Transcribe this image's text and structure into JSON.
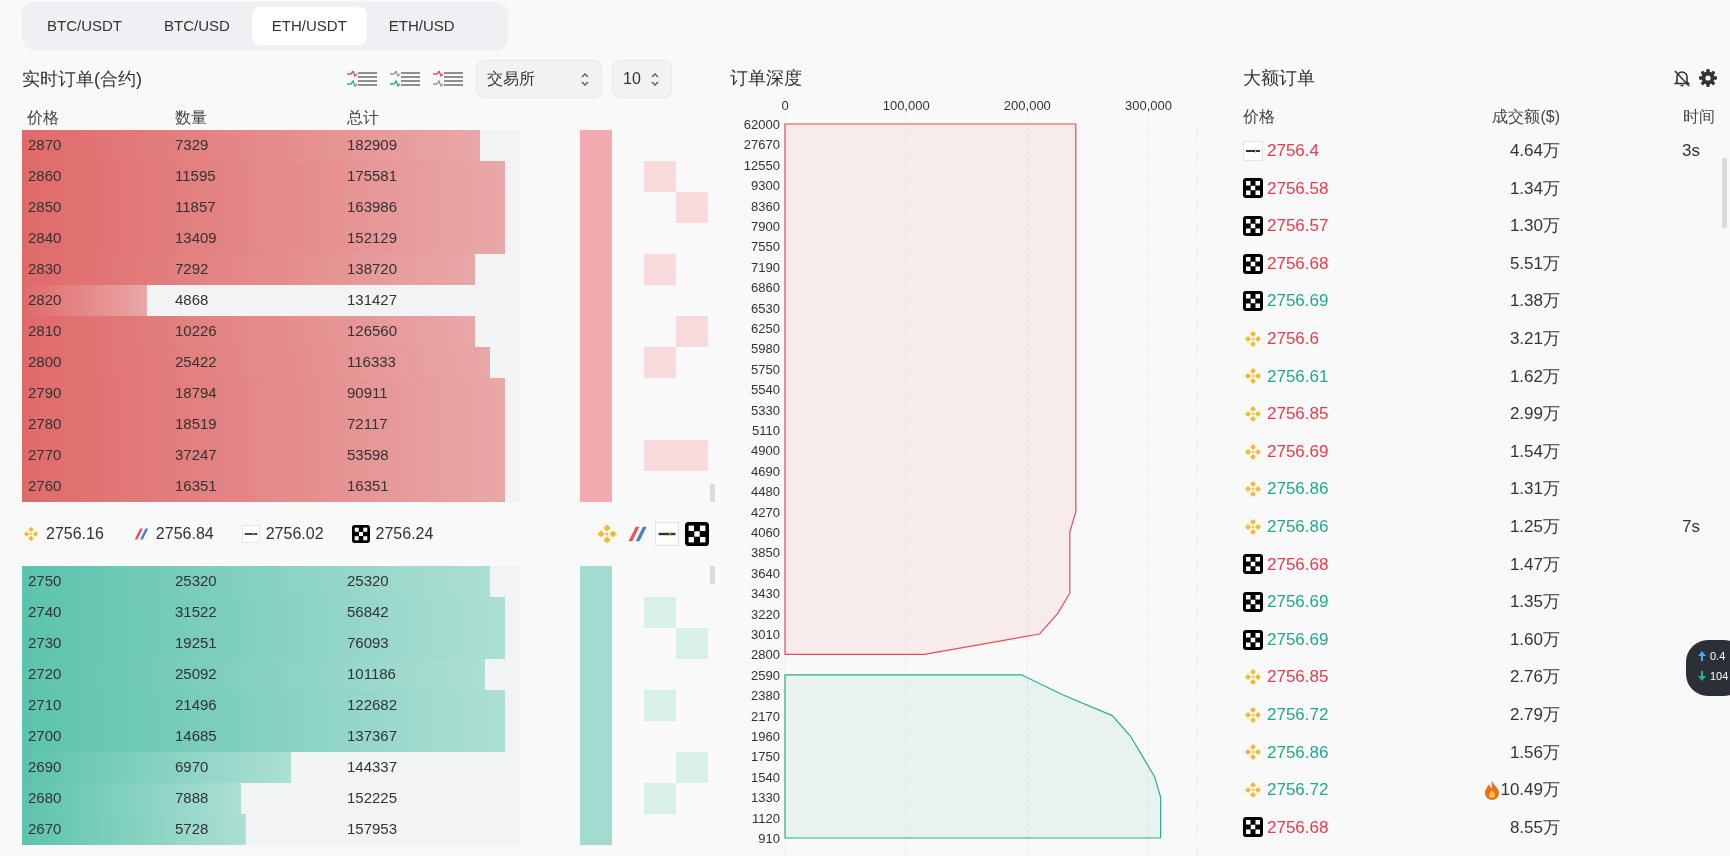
{
  "tabs": [
    {
      "label": "BTC/USDT",
      "selected": false
    },
    {
      "label": "BTC/USD",
      "selected": false
    },
    {
      "label": "ETH/USDT",
      "selected": true
    },
    {
      "label": "ETH/USD",
      "selected": false
    }
  ],
  "order_book": {
    "title": "实时订单(合约)",
    "exchange_select": "交易所",
    "depth_select": "10",
    "columns": [
      "价格",
      "数量",
      "总计"
    ],
    "asks": [
      {
        "price": "2870",
        "qty": "7329",
        "total": "182909",
        "level": 0.92
      },
      {
        "price": "2860",
        "qty": "11595",
        "total": "175581",
        "level": 0.97
      },
      {
        "price": "2850",
        "qty": "11857",
        "total": "163986",
        "level": 0.97
      },
      {
        "price": "2840",
        "qty": "13409",
        "total": "152129",
        "level": 0.97
      },
      {
        "price": "2830",
        "qty": "7292",
        "total": "138720",
        "level": 0.91
      },
      {
        "price": "2820",
        "qty": "4868",
        "total": "131427",
        "level": 0.25
      },
      {
        "price": "2810",
        "qty": "10226",
        "total": "126560",
        "level": 0.91
      },
      {
        "price": "2800",
        "qty": "25422",
        "total": "116333",
        "level": 0.94
      },
      {
        "price": "2790",
        "qty": "18794",
        "total": "90911",
        "level": 0.97
      },
      {
        "price": "2780",
        "qty": "18519",
        "total": "72117",
        "level": 0.97
      },
      {
        "price": "2770",
        "qty": "37247",
        "total": "53598",
        "level": 0.97
      },
      {
        "price": "2760",
        "qty": "16351",
        "total": "16351",
        "level": 0.97
      }
    ],
    "exchange_prices": [
      {
        "kind": "binance",
        "price": "2756.16"
      },
      {
        "kind": "bitmex",
        "price": "2756.84"
      },
      {
        "kind": "bybit",
        "price": "2756.02"
      },
      {
        "kind": "okx",
        "price": "2756.24"
      }
    ],
    "exchange_legend": [
      {
        "kind": "binance"
      },
      {
        "kind": "bitmex"
      },
      {
        "kind": "bybit"
      },
      {
        "kind": "okx"
      }
    ],
    "bids": [
      {
        "price": "2750",
        "qty": "25320",
        "total": "25320",
        "level": 0.94
      },
      {
        "price": "2740",
        "qty": "31522",
        "total": "56842",
        "level": 0.97
      },
      {
        "price": "2730",
        "qty": "19251",
        "total": "76093",
        "level": 0.97
      },
      {
        "price": "2720",
        "qty": "25092",
        "total": "101186",
        "level": 0.93
      },
      {
        "price": "2710",
        "qty": "21496",
        "total": "122682",
        "level": 0.97
      },
      {
        "price": "2700",
        "qty": "14685",
        "total": "137367",
        "level": 0.97
      },
      {
        "price": "2690",
        "qty": "6970",
        "total": "144337",
        "level": 0.54
      },
      {
        "price": "2680",
        "qty": "7888",
        "total": "152225",
        "level": 0.44
      },
      {
        "price": "2670",
        "qty": "5728",
        "total": "157953",
        "level": 0.45
      }
    ]
  },
  "depth": {
    "title": "订单深度",
    "chart_data": {
      "type": "area",
      "orientation": "horizontal",
      "grid": true,
      "categories": [
        "62000",
        "27670",
        "12550",
        "9300",
        "8360",
        "7900",
        "7550",
        "7190",
        "6860",
        "6530",
        "6250",
        "5980",
        "5750",
        "5540",
        "5330",
        "5110",
        "4900",
        "4690",
        "4480",
        "4270",
        "4060",
        "3850",
        "3640",
        "3430",
        "3220",
        "3010",
        "2800",
        "2590",
        "2380",
        "2170",
        "1960",
        "1750",
        "1540",
        "1330",
        "1120",
        "910"
      ],
      "series": [
        {
          "color": "#f04858",
          "values": [
            240000,
            240000,
            240000,
            240000,
            240000,
            240000,
            240000,
            240000,
            240000,
            240000,
            240000,
            240000,
            240000,
            240000,
            240000,
            240000,
            240000,
            240000,
            240000,
            240000,
            235000,
            235000,
            235000,
            235000,
            225000,
            210000,
            115000,
            null,
            null,
            null,
            null,
            null,
            null,
            null,
            null,
            null
          ]
        },
        {
          "color": "#27b08e",
          "values": [
            null,
            null,
            null,
            null,
            null,
            null,
            null,
            null,
            null,
            null,
            null,
            null,
            null,
            null,
            null,
            null,
            null,
            null,
            null,
            null,
            null,
            null,
            null,
            null,
            null,
            null,
            null,
            195000,
            230000,
            270000,
            285000,
            295000,
            305000,
            310000,
            310000,
            310000
          ]
        }
      ],
      "xlim": [
        0,
        340000
      ],
      "xticks": [
        {
          "value": 0,
          "label": "0"
        },
        {
          "value": 100000,
          "label": "100,000"
        },
        {
          "value": 200000,
          "label": "200,000"
        },
        {
          "value": 300000,
          "label": "300,000"
        }
      ]
    }
  },
  "large_orders": {
    "title": "大额订单",
    "columns": [
      "价格",
      "成交额($)",
      "时间"
    ],
    "rows": [
      {
        "kind": "bybit",
        "price": "2756.4",
        "color": "#f0384a",
        "amount": "4.64万",
        "hot": false,
        "time": "3s"
      },
      {
        "kind": "okx",
        "price": "2756.58",
        "color": "#f0384a",
        "amount": "1.34万",
        "hot": false
      },
      {
        "kind": "okx",
        "price": "2756.57",
        "color": "#f0384a",
        "amount": "1.30万",
        "hot": false
      },
      {
        "kind": "okx",
        "price": "2756.68",
        "color": "#f0384a",
        "amount": "5.51万",
        "hot": false
      },
      {
        "kind": "okx",
        "price": "2756.69",
        "color": "#1fa98a",
        "amount": "1.38万",
        "hot": false
      },
      {
        "kind": "binance",
        "price": "2756.6",
        "color": "#f0384a",
        "amount": "3.21万",
        "hot": false
      },
      {
        "kind": "binance",
        "price": "2756.61",
        "color": "#1fa98a",
        "amount": "1.62万",
        "hot": false
      },
      {
        "kind": "binance",
        "price": "2756.85",
        "color": "#f0384a",
        "amount": "2.99万",
        "hot": false
      },
      {
        "kind": "binance",
        "price": "2756.69",
        "color": "#f0384a",
        "amount": "1.54万",
        "hot": false
      },
      {
        "kind": "binance",
        "price": "2756.86",
        "color": "#1fa98a",
        "amount": "1.31万",
        "hot": false
      },
      {
        "kind": "binance",
        "price": "2756.86",
        "color": "#1fa98a",
        "amount": "1.25万",
        "hot": false,
        "time": "7s"
      },
      {
        "kind": "okx",
        "price": "2756.68",
        "color": "#f0384a",
        "amount": "1.47万",
        "hot": false
      },
      {
        "kind": "okx",
        "price": "2756.69",
        "color": "#1fa98a",
        "amount": "1.35万",
        "hot": false
      },
      {
        "kind": "okx",
        "price": "2756.69",
        "color": "#1fa98a",
        "amount": "1.60万",
        "hot": false
      },
      {
        "kind": "binance",
        "price": "2756.85",
        "color": "#f0384a",
        "amount": "2.76万",
        "hot": false
      },
      {
        "kind": "binance",
        "price": "2756.72",
        "color": "#1fa98a",
        "amount": "2.79万",
        "hot": false
      },
      {
        "kind": "binance",
        "price": "2756.86",
        "color": "#1fa98a",
        "amount": "1.56万",
        "hot": false
      },
      {
        "kind": "binance",
        "price": "2756.72",
        "color": "#1fa98a",
        "amount": "10.49万",
        "hot": true
      },
      {
        "kind": "okx",
        "price": "2756.68",
        "color": "#f0384a",
        "amount": "8.55万",
        "hot": false
      }
    ]
  },
  "float_widget": {
    "up": "0.4",
    "down": "104"
  }
}
